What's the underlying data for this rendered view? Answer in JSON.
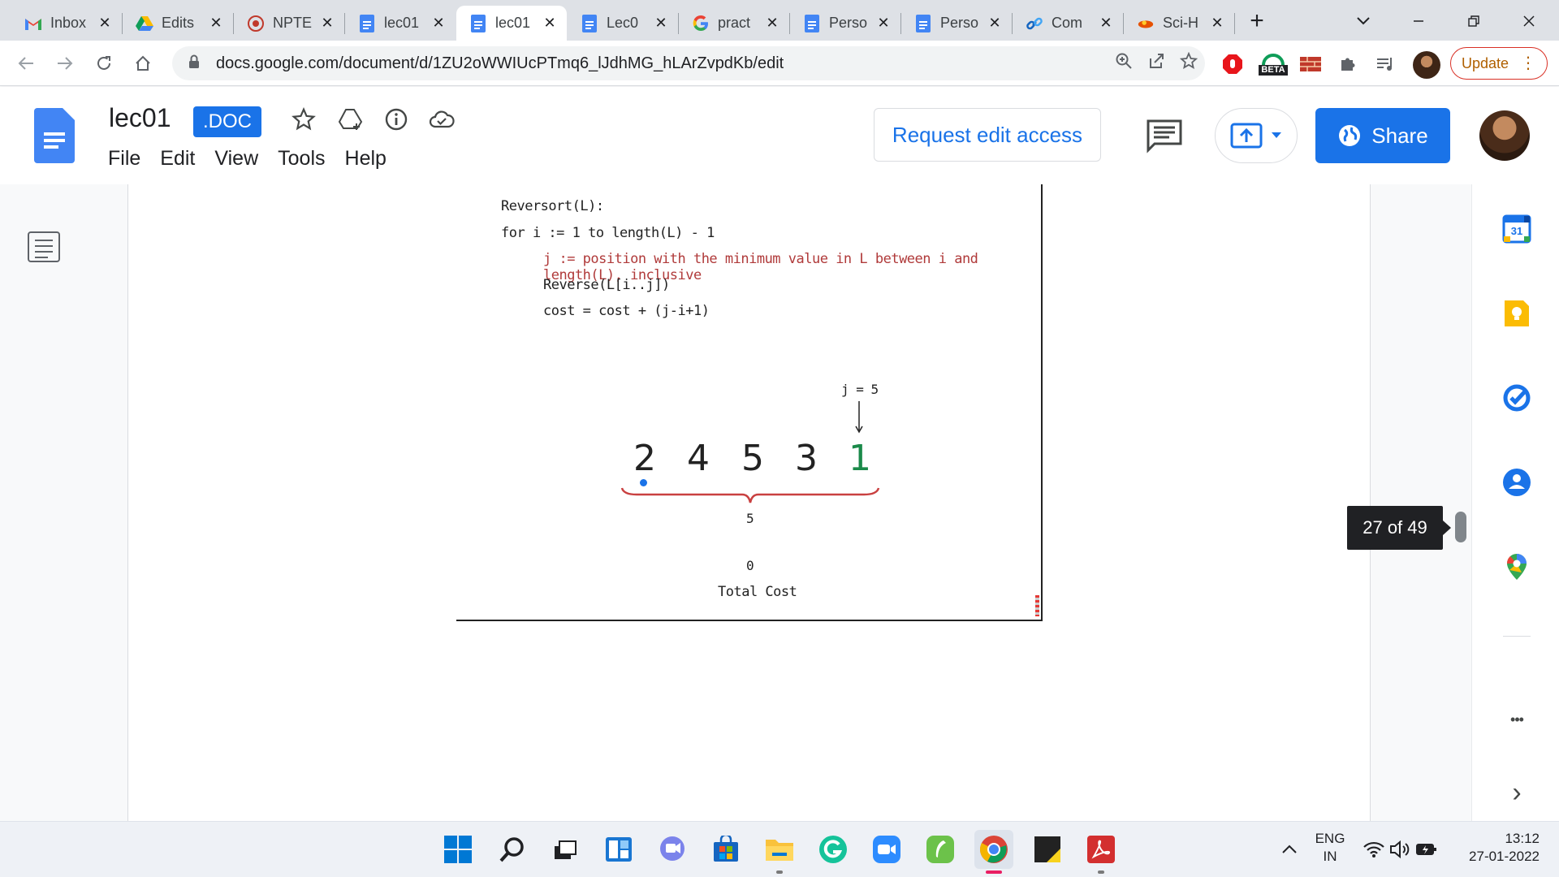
{
  "browser": {
    "tabs": [
      {
        "title": "Inbox",
        "icon": "gmail-icon",
        "active": false
      },
      {
        "title": "Edits",
        "icon": "google-drive-icon",
        "active": false
      },
      {
        "title": "NPTE",
        "icon": "nptel-icon",
        "active": false
      },
      {
        "title": "lec01",
        "icon": "google-docs-icon",
        "active": false
      },
      {
        "title": "lec01",
        "icon": "google-docs-icon",
        "active": true
      },
      {
        "title": "Lec0",
        "icon": "google-docs-icon",
        "active": false
      },
      {
        "title": "pract",
        "icon": "google-icon",
        "active": false
      },
      {
        "title": "Perso",
        "icon": "google-docs-icon",
        "active": false
      },
      {
        "title": "Perso",
        "icon": "google-docs-icon",
        "active": false
      },
      {
        "title": "Com",
        "icon": "link-icon",
        "active": false
      },
      {
        "title": "Sci-H",
        "icon": "sci-hub-icon",
        "active": false
      }
    ],
    "tab_close": "✕",
    "new_tab": "+",
    "url": "docs.google.com/document/d/1ZU2oWWIUcPTmq6_lJdhMG_hLArZvpdKb/edit",
    "extension_badge": "BETA",
    "update_label": "Update"
  },
  "docs": {
    "title": "lec01",
    "badge": ".DOC",
    "menu": [
      "File",
      "Edit",
      "View",
      "Tools",
      "Help"
    ],
    "request_edit": "Request edit access",
    "share": "Share",
    "page_indicator": "27 of 49",
    "colors": {
      "accent": "#1a73e8",
      "code_red": "#b03a3a",
      "green": "#1b8a4a"
    }
  },
  "slide": {
    "code": [
      "Reversort(L):",
      "for i := 1 to length(L) - 1",
      "j := position with the minimum value in L between i and length(L), inclusive",
      "Reverse(L[i..j])",
      "cost = cost + (j-i+1)"
    ],
    "pointer_label": "j = 5",
    "array": [
      "2",
      "4",
      "5",
      "3",
      "1"
    ],
    "span_length": "5",
    "total_cost_value": "0",
    "total_cost_label": "Total Cost"
  },
  "side_apps": [
    "calendar-icon",
    "keep-icon",
    "tasks-icon",
    "contacts-icon",
    "maps-icon"
  ],
  "calendar_day": "31",
  "side_more": "•••",
  "side_expand": "›",
  "taskbar": {
    "lang_top": "ENG",
    "lang_bottom": "IN",
    "time": "13:12",
    "date": "27-01-2022"
  }
}
